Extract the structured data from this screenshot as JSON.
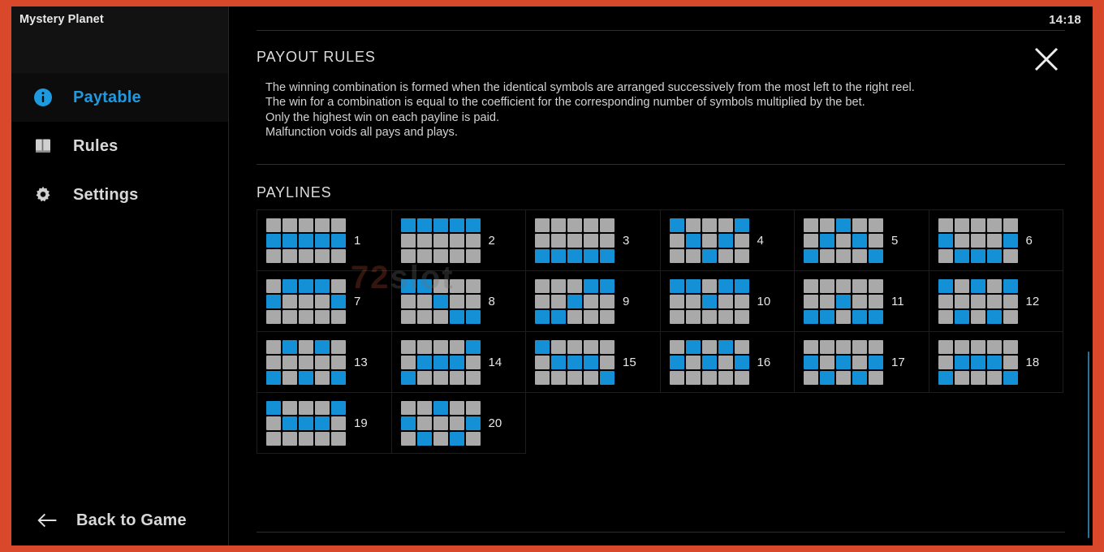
{
  "window": {
    "game_title": "Mystery Planet",
    "clock": "14:18",
    "accent_blue": "#1e9ae0",
    "border_orange": "#d9482b",
    "cell_off_color": "#a9a9a9",
    "cell_on_color": "#1490d6"
  },
  "sidebar": {
    "items": [
      {
        "label": "Paytable",
        "icon": "info-icon",
        "active": true
      },
      {
        "label": "Rules",
        "icon": "book-icon",
        "active": false
      },
      {
        "label": "Settings",
        "icon": "gear-icon",
        "active": false
      }
    ],
    "back": {
      "label": "Back to Game",
      "icon": "arrow-left-icon"
    }
  },
  "main": {
    "close_icon": "close-icon",
    "payout_rules": {
      "title": "PAYOUT RULES",
      "lines": [
        "The winning combination is formed when the identical symbols are arranged successively from the most left to the right reel.",
        "The win for a combination is equal to the coefficient for the corresponding number of symbols multiplied by the bet.",
        "Only the highest win on each payline is paid.",
        "Malfunction voids all pays and plays."
      ]
    },
    "paylines_title": "PAYLINES"
  },
  "watermark": {
    "part1": "72",
    "part2": "slot"
  },
  "chart_data": {
    "type": "table",
    "title": "PAYLINES",
    "description": "20 payline patterns on a 5-reel x 3-row grid. Each pattern lists, per reel (left to right), the highlighted row index: 0 = top, 1 = middle, 2 = bottom.",
    "reels": 5,
    "rows": 3,
    "paylines": [
      {
        "number": "1",
        "rows": [
          1,
          1,
          1,
          1,
          1
        ]
      },
      {
        "number": "2",
        "rows": [
          0,
          0,
          0,
          0,
          0
        ]
      },
      {
        "number": "3",
        "rows": [
          2,
          2,
          2,
          2,
          2
        ]
      },
      {
        "number": "4",
        "rows": [
          0,
          1,
          2,
          1,
          0
        ]
      },
      {
        "number": "5",
        "rows": [
          2,
          1,
          0,
          1,
          2
        ]
      },
      {
        "number": "6",
        "rows": [
          1,
          2,
          2,
          2,
          1
        ]
      },
      {
        "number": "7",
        "rows": [
          1,
          0,
          0,
          0,
          1
        ]
      },
      {
        "number": "8",
        "rows": [
          0,
          0,
          1,
          2,
          2
        ]
      },
      {
        "number": "9",
        "rows": [
          2,
          2,
          1,
          0,
          0
        ]
      },
      {
        "number": "10",
        "rows": [
          0,
          0,
          1,
          0,
          0
        ]
      },
      {
        "number": "11",
        "rows": [
          2,
          2,
          1,
          2,
          2
        ]
      },
      {
        "number": "12",
        "rows": [
          0,
          2,
          0,
          2,
          0
        ]
      },
      {
        "number": "13",
        "rows": [
          2,
          0,
          2,
          0,
          2
        ]
      },
      {
        "number": "14",
        "rows": [
          2,
          1,
          1,
          1,
          0
        ]
      },
      {
        "number": "15",
        "rows": [
          0,
          1,
          1,
          1,
          2
        ]
      },
      {
        "number": "16",
        "rows": [
          1,
          0,
          1,
          0,
          1
        ]
      },
      {
        "number": "17",
        "rows": [
          1,
          2,
          1,
          2,
          1
        ]
      },
      {
        "number": "18",
        "rows": [
          2,
          1,
          1,
          1,
          2
        ]
      },
      {
        "number": "19",
        "rows": [
          0,
          1,
          1,
          1,
          0
        ]
      },
      {
        "number": "20",
        "rows": [
          1,
          2,
          0,
          2,
          1
        ]
      }
    ]
  }
}
